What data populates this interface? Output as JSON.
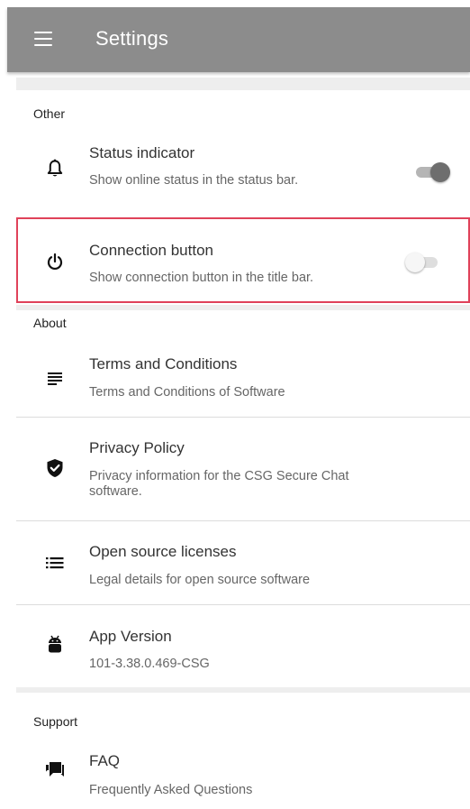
{
  "appbar": {
    "title": "Settings",
    "menu_icon": "menu-icon",
    "background": "#8c8c8c"
  },
  "sections": {
    "other": {
      "header": "Other",
      "items": [
        {
          "title": "Status indicator",
          "subtitle": "Show online status in the status bar.",
          "icon": "bell-icon",
          "toggle": "on"
        },
        {
          "title": "Connection button",
          "subtitle": "Show connection button in the title bar.",
          "icon": "power-icon",
          "toggle": "off",
          "highlight_color": "#e0425a"
        }
      ]
    },
    "about": {
      "header": "About",
      "items": [
        {
          "title": "Terms and Conditions",
          "subtitle": "Terms and Conditions of Software",
          "icon": "document-lines-icon"
        },
        {
          "title": "Privacy Policy",
          "subtitle": "Privacy information for the CSG Secure Chat software.",
          "icon": "shield-check-icon"
        },
        {
          "title": "Open source licenses",
          "subtitle": "Legal details for open source software",
          "icon": "list-icon"
        },
        {
          "title": "App Version",
          "subtitle": "101-3.38.0.469-CSG",
          "icon": "android-icon"
        }
      ]
    },
    "support": {
      "header": "Support",
      "items": [
        {
          "title": "FAQ",
          "subtitle": "Frequently Asked Questions",
          "icon": "chat-icon"
        }
      ]
    }
  }
}
